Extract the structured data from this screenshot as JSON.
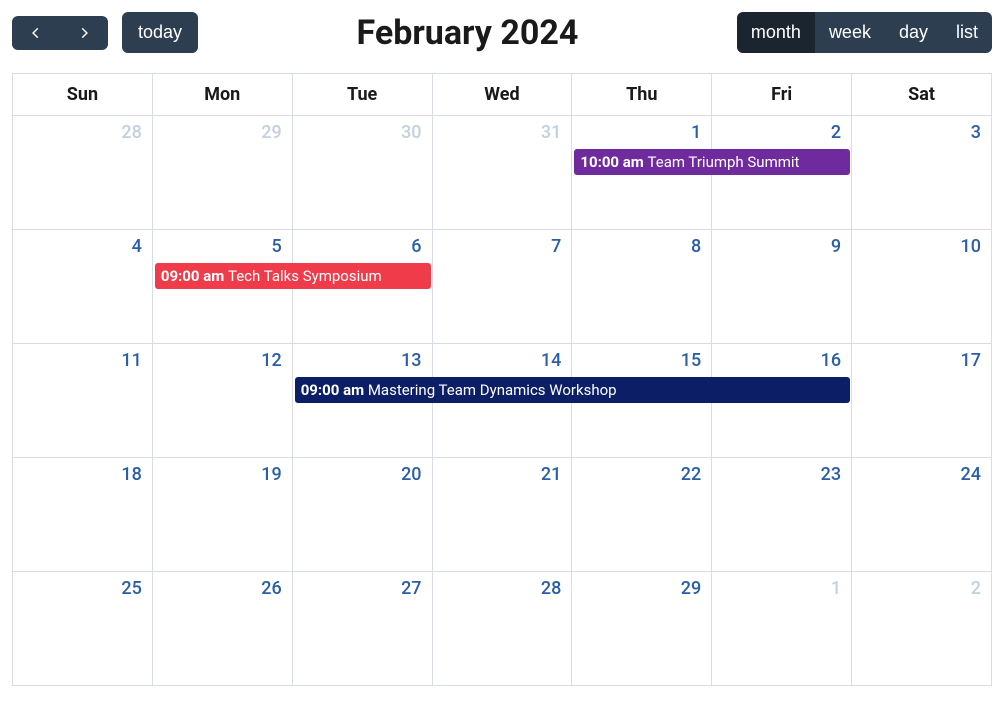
{
  "toolbar": {
    "today_label": "today",
    "title": "February 2024",
    "views": {
      "month": "month",
      "week": "week",
      "day": "day",
      "list": "list"
    }
  },
  "dayHeaders": [
    "Sun",
    "Mon",
    "Tue",
    "Wed",
    "Thu",
    "Fri",
    "Sat"
  ],
  "weeks": [
    [
      {
        "num": "28",
        "other": true
      },
      {
        "num": "29",
        "other": true
      },
      {
        "num": "30",
        "other": true
      },
      {
        "num": "31",
        "other": true
      },
      {
        "num": "1"
      },
      {
        "num": "2"
      },
      {
        "num": "3"
      }
    ],
    [
      {
        "num": "4"
      },
      {
        "num": "5"
      },
      {
        "num": "6"
      },
      {
        "num": "7"
      },
      {
        "num": "8"
      },
      {
        "num": "9"
      },
      {
        "num": "10"
      }
    ],
    [
      {
        "num": "11"
      },
      {
        "num": "12"
      },
      {
        "num": "13"
      },
      {
        "num": "14"
      },
      {
        "num": "15"
      },
      {
        "num": "16"
      },
      {
        "num": "17"
      }
    ],
    [
      {
        "num": "18"
      },
      {
        "num": "19"
      },
      {
        "num": "20"
      },
      {
        "num": "21"
      },
      {
        "num": "22"
      },
      {
        "num": "23"
      },
      {
        "num": "24"
      }
    ],
    [
      {
        "num": "25"
      },
      {
        "num": "26"
      },
      {
        "num": "27"
      },
      {
        "num": "28"
      },
      {
        "num": "29"
      },
      {
        "num": "1",
        "other": true
      },
      {
        "num": "2",
        "other": true
      }
    ]
  ],
  "events": [
    {
      "row": 0,
      "startCol": 4,
      "span": 2,
      "time": "10:00 am",
      "title": "Team Triumph Summit",
      "color": "#6f2b9e"
    },
    {
      "row": 1,
      "startCol": 1,
      "span": 2,
      "time": "09:00 am",
      "title": "Tech Talks Symposium",
      "color": "#ef3b4a"
    },
    {
      "row": 2,
      "startCol": 2,
      "span": 4,
      "time": "09:00 am",
      "title": "Mastering Team Dynamics Workshop",
      "color": "#0b1e66"
    }
  ]
}
